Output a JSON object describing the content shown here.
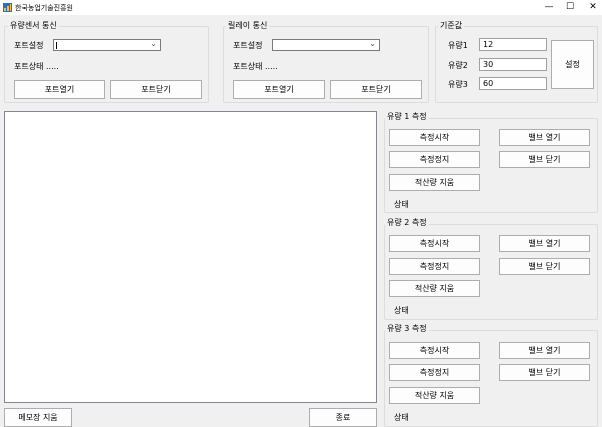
{
  "window": {
    "title": "한국농업기술진흥원",
    "minimize": "—",
    "maximize": "☐",
    "close": "✕"
  },
  "sensor_comm": {
    "legend": "유량센서 통신",
    "port_setting_label": "포트설정",
    "port_value": "",
    "port_status": "포트상태 .....",
    "open_button": "포트열기",
    "close_button": "포트닫기"
  },
  "relay_comm": {
    "legend": "릴레이 통신",
    "port_setting_label": "포트설정",
    "port_value": "",
    "port_status": "포트상태 .....",
    "open_button": "포트열기",
    "close_button": "포트닫기"
  },
  "reference": {
    "legend": "기준값",
    "rows": [
      {
        "label": "유량1",
        "value": "12"
      },
      {
        "label": "유량2",
        "value": "30"
      },
      {
        "label": "유량3",
        "value": "60"
      }
    ],
    "set_button": "설정"
  },
  "flows": [
    {
      "legend": "유량 1 측정",
      "start": "측정시작",
      "stop": "측정정지",
      "erase": "적산량 지움",
      "valve_open": "밸브 열기",
      "valve_close": "밸브 닫기",
      "status": "상태"
    },
    {
      "legend": "유량 2 측정",
      "start": "측정시작",
      "stop": "측정정지",
      "erase": "적산량 지움",
      "valve_open": "밸브 열기",
      "valve_close": "밸브 닫기",
      "status": "상태"
    },
    {
      "legend": "유량 3 측정",
      "start": "측정시작",
      "stop": "측정정지",
      "erase": "적산량 지움",
      "valve_open": "밸브 열기",
      "valve_close": "밸브 닫기",
      "status": "상태"
    }
  ],
  "bottom": {
    "clear_memo": "메모장 지움",
    "exit": "종료"
  }
}
